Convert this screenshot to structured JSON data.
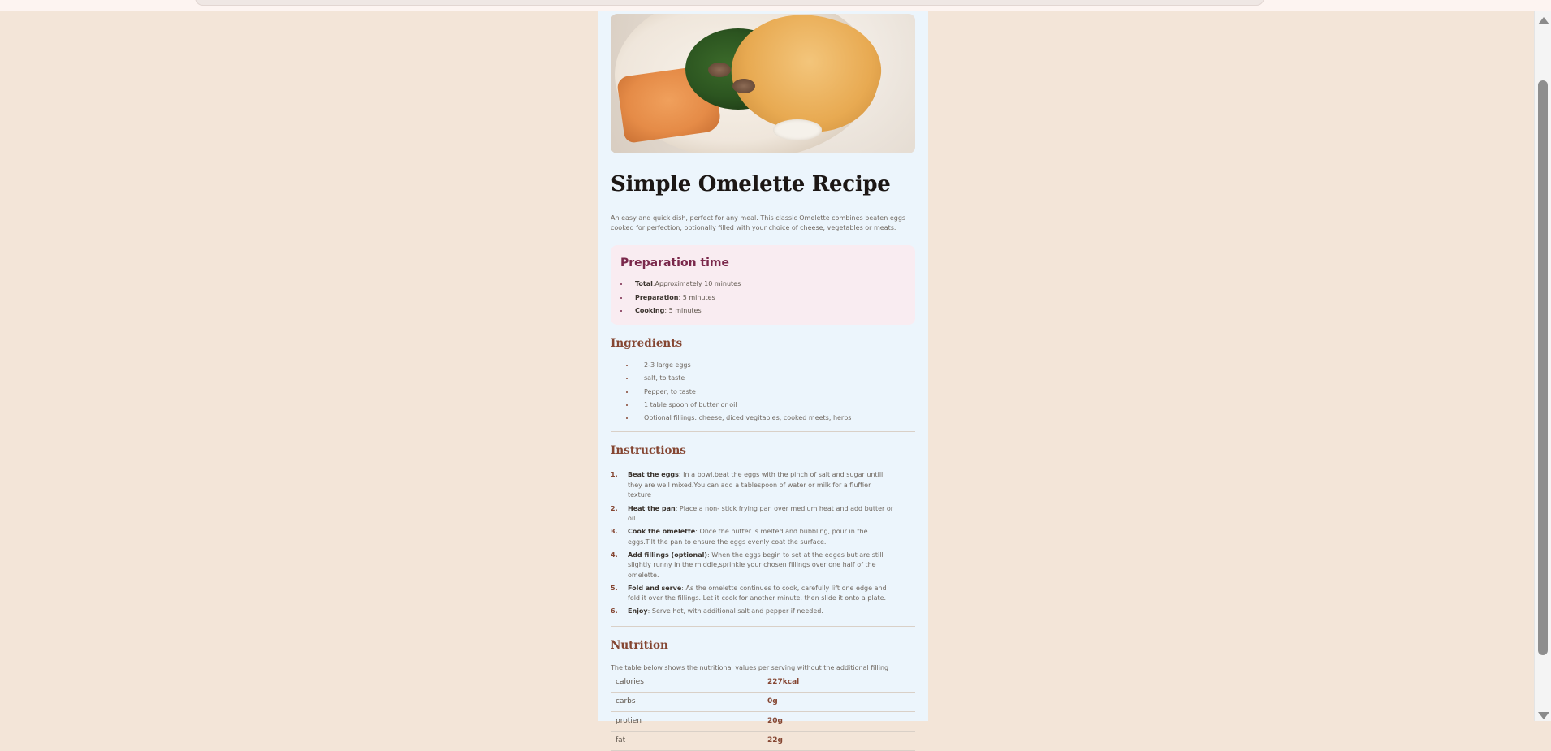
{
  "recipe": {
    "image_alt": "omelette-photo",
    "title": "Simple Omelette Recipe",
    "intro": "An easy and quick dish, perfect for any meal. This classic Omelette combines beaten eggs cooked for perfection, optionally filled with your choice of cheese, vegetables or meats."
  },
  "prep": {
    "title": "Preparation time",
    "items": [
      {
        "label": "Total",
        "text": ":Approximately 10 minutes"
      },
      {
        "label": "Preparation",
        "text": ": 5 minutes"
      },
      {
        "label": "Cooking",
        "text": ": 5 minutes"
      }
    ]
  },
  "ingredients": {
    "title": "Ingredients",
    "items": [
      "2-3 large eggs",
      "salt, to taste",
      "Pepper, to taste",
      "1 table spoon of butter or oil",
      "Optional fillings: cheese, diced vegitables, cooked meets, herbs"
    ]
  },
  "instructions": {
    "title": "Instructions",
    "steps": [
      {
        "num": "1.",
        "label": "Beat the eggs",
        "text": ": In a bowl,beat the eggs with the pinch of salt and sugar untill they are well mixed.You can add a tablespoon of water or milk for a fluffier texture"
      },
      {
        "num": "2.",
        "label": "Heat the pan",
        "text": ": Place a non- stick frying pan over medium heat and add butter or oil"
      },
      {
        "num": "3.",
        "label": "Cook the omelette",
        "text": ": Once the butter is melted and bubbling, pour in the eggs.Tilt the pan to ensure the eggs evenly coat the surface."
      },
      {
        "num": "4.",
        "label": "Add fillings (optional)",
        "text": ": When the eggs begin to set at the edges but are still slightly runny in the middle,sprinkle your chosen fillings over one half of the omelette."
      },
      {
        "num": "5.",
        "label": "Fold and serve",
        "text": ": As the omelette continues to cook, carefully lift one edge and fold it over the fillings. Let it cook for another minute, then slide it onto a plate."
      },
      {
        "num": "6.",
        "label": "Enjoy",
        "text": ": Serve hot, with additional salt and pepper if needed."
      }
    ]
  },
  "nutrition": {
    "title": "Nutrition",
    "intro": "The table below shows the nutritional values per serving without the additional filling",
    "rows": [
      {
        "name": "calories",
        "value": "227kcal"
      },
      {
        "name": "carbs",
        "value": "0g"
      },
      {
        "name": "protien",
        "value": "20g"
      },
      {
        "name": "fat",
        "value": "22g"
      }
    ]
  }
}
